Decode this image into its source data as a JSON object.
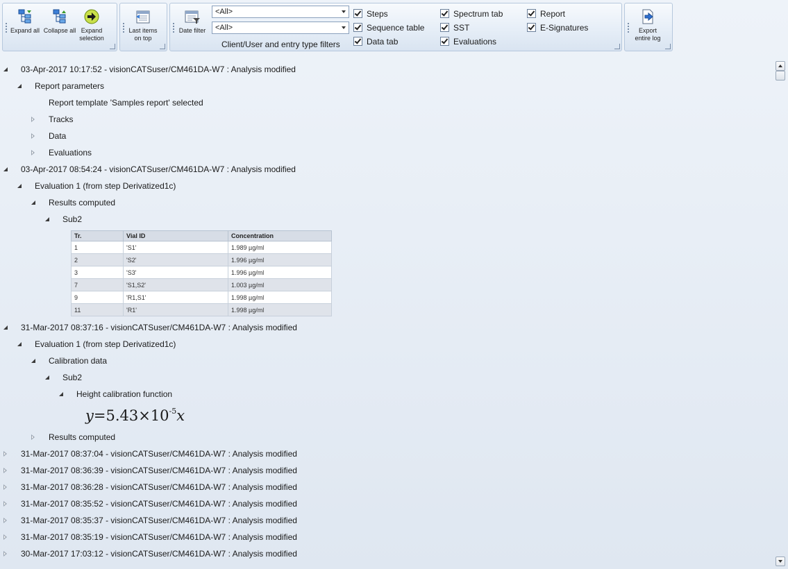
{
  "ribbon": {
    "expand_all": "Expand all",
    "collapse_all": "Collapse all",
    "expand_selection": "Expand selection",
    "last_items_on_top": "Last items on top",
    "date_filter": "Date filter",
    "client_combo_value": "<All>",
    "entry_combo_value": "<All>",
    "filters_caption": "Client/User and entry type filters",
    "export_entire_log": "Export entire log",
    "checkboxes": [
      {
        "label": "Steps",
        "checked": true
      },
      {
        "label": "Sequence table",
        "checked": true
      },
      {
        "label": "Data tab",
        "checked": true
      },
      {
        "label": "Spectrum tab",
        "checked": true
      },
      {
        "label": "SST",
        "checked": true
      },
      {
        "label": "Evaluations",
        "checked": true
      },
      {
        "label": "Report",
        "checked": true
      },
      {
        "label": "E-Signatures",
        "checked": true
      }
    ]
  },
  "log": {
    "entry1": {
      "header": "03-Apr-2017 10:17:52 - visionCATSuser/CM461DA-W7 : Analysis modified",
      "report_parameters": "Report parameters",
      "template_selected": "Report template 'Samples report' selected",
      "tracks": "Tracks",
      "data": "Data",
      "evaluations": "Evaluations"
    },
    "entry2": {
      "header": "03-Apr-2017 08:54:24 - visionCATSuser/CM461DA-W7 : Analysis modified",
      "evaluation": "Evaluation 1 (from step Derivatized1c)",
      "results_computed": "Results computed",
      "sub": "Sub2",
      "table": {
        "headers": [
          "Tr.",
          "Vial ID",
          "Concentration"
        ],
        "rows": [
          [
            "1",
            "'S1'",
            "1.989 µg/ml"
          ],
          [
            "2",
            "'S2'",
            "1.996 µg/ml"
          ],
          [
            "3",
            "'S3'",
            "1.996 µg/ml"
          ],
          [
            "7",
            "'S1,S2'",
            "1.003 µg/ml"
          ],
          [
            "9",
            "'R1,S1'",
            "1.998 µg/ml"
          ],
          [
            "11",
            "'R1'",
            "1.998 µg/ml"
          ]
        ]
      }
    },
    "entry3": {
      "header": "31-Mar-2017 08:37:16 - visionCATSuser/CM461DA-W7 : Analysis modified",
      "evaluation": "Evaluation 1 (from step Derivatized1c)",
      "calibration_data": "Calibration data",
      "sub": "Sub2",
      "height_calibration": "Height calibration function",
      "formula": {
        "lhs": "y",
        "eq": "=5.43×10",
        "exp": "-5",
        "rhs": "x"
      },
      "results_computed": "Results computed"
    },
    "collapsed_entries": [
      "31-Mar-2017 08:37:04 - visionCATSuser/CM461DA-W7 : Analysis modified",
      "31-Mar-2017 08:36:39 - visionCATSuser/CM461DA-W7 : Analysis modified",
      "31-Mar-2017 08:36:28 - visionCATSuser/CM461DA-W7 : Analysis modified",
      "31-Mar-2017 08:35:52 - visionCATSuser/CM461DA-W7 : Analysis modified",
      "31-Mar-2017 08:35:37 - visionCATSuser/CM461DA-W7 : Analysis modified",
      "31-Mar-2017 08:35:19 - visionCATSuser/CM461DA-W7 : Analysis modified",
      "30-Mar-2017 17:03:12 - visionCATSuser/CM461DA-W7 : Analysis modified"
    ]
  },
  "colors": {
    "background": "#e4ebf4",
    "ribbon_border": "#b6c8dd",
    "table_header": "#d7dde6",
    "table_alt_row": "#dfe3ea"
  },
  "icons": {
    "expand_all": "tree-expand-icon",
    "collapse_all": "tree-collapse-icon",
    "expand_selection": "arrow-right-circle-icon",
    "last_items_on_top": "calendar-list-icon",
    "date_filter": "calendar-filter-icon",
    "export": "document-export-icon"
  }
}
